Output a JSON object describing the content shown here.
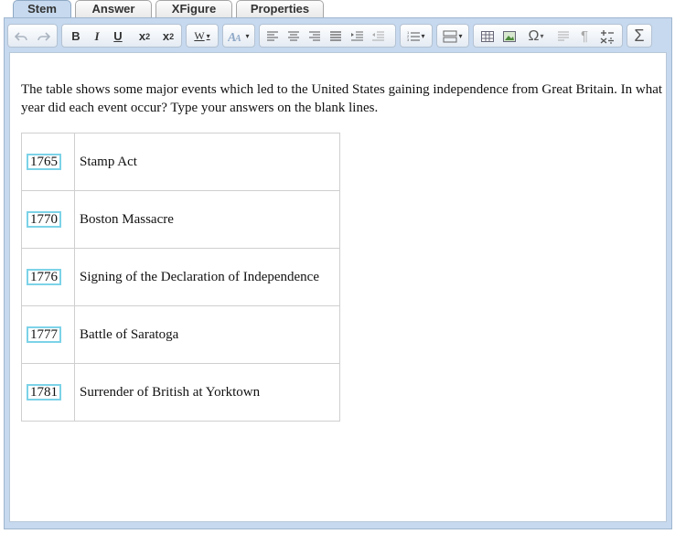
{
  "tabs": [
    {
      "label": "Stem",
      "active": true
    },
    {
      "label": "Answer",
      "active": false
    },
    {
      "label": "XFigure",
      "active": false
    },
    {
      "label": "Properties",
      "active": false
    }
  ],
  "toolbar": {
    "undo_icon": "undo-icon",
    "redo_icon": "redo-icon",
    "bold_label": "B",
    "italic_label": "I",
    "underline_label": "U",
    "subscript_label": "x",
    "subscript_sub": "2",
    "superscript_label": "x",
    "superscript_sup": "2",
    "styles_label": "W",
    "font_icon": "font-size-icon",
    "omega_label": "Ω",
    "sigma_label": "Σ",
    "pilcrow_label": "¶"
  },
  "stem": {
    "text": "The table shows some major events which led to the United States gaining independence from Great Britain. In what year did each event occur? Type your answers on the blank lines."
  },
  "events": [
    {
      "year": "1765",
      "event": "Stamp Act"
    },
    {
      "year": "1770",
      "event": "Boston Massacre"
    },
    {
      "year": "1776",
      "event": "Signing of the Declaration of Independence"
    },
    {
      "year": "1777",
      "event": "Battle of Saratoga"
    },
    {
      "year": "1781",
      "event": "Surrender of British at Yorktown"
    }
  ],
  "colors": {
    "frame": "#c6d9ee",
    "input_border": "#7cd3e8"
  }
}
